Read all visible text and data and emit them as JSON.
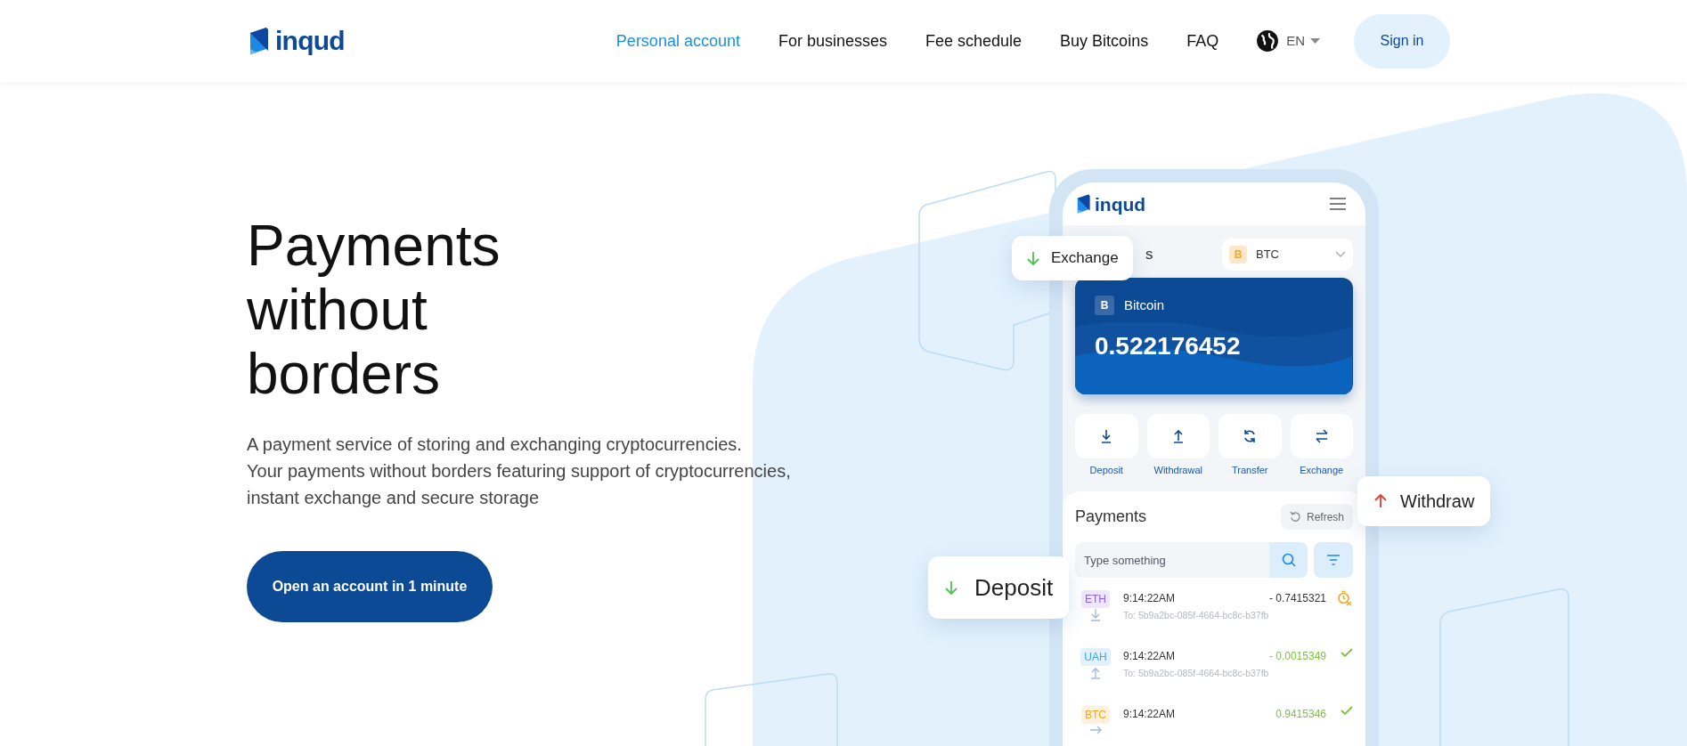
{
  "header": {
    "logo": "inqud",
    "nav": [
      {
        "label": "Personal account",
        "selected": true
      },
      {
        "label": "For businesses",
        "selected": false
      },
      {
        "label": "Fee schedule",
        "selected": false
      },
      {
        "label": "Buy Bitcoins",
        "selected": false
      },
      {
        "label": "FAQ",
        "selected": false
      }
    ],
    "language": "EN",
    "sign_in": "Sign in"
  },
  "hero": {
    "title_lines": [
      "Payments",
      "without",
      "borders"
    ],
    "description_lines": [
      "A payment service of storing and exchanging cryptocurrencies.",
      "Your payments without borders featuring support of cryptocurrencies,",
      "instant exchange and secure storage"
    ],
    "cta": "Open an account in 1 minute"
  },
  "phone": {
    "logo": "inqud",
    "section_title_visible": "s",
    "currency": {
      "symbol": "B",
      "code": "BTC"
    },
    "card": {
      "symbol": "B",
      "name": "Bitcoin",
      "balance": "0.522176452"
    },
    "actions": [
      {
        "kind": "deposit",
        "label": "Deposit"
      },
      {
        "kind": "withdrawal",
        "label": "Withdrawal"
      },
      {
        "kind": "transfer",
        "label": "Transfer"
      },
      {
        "kind": "exchange",
        "label": "Exchange"
      }
    ],
    "payments": {
      "title": "Payments",
      "refresh": "Refresh",
      "search_placeholder": "Type something",
      "rows": [
        {
          "coin": "ETH",
          "color": "#8b5cf6",
          "time": "9:14:22AM",
          "amount": "- 0.7415321",
          "to": "To: 5b9a2bc-085f-4664-bc8c-b37fb",
          "kind": "deposit",
          "pending": true
        },
        {
          "coin": "UAH",
          "color": "#38a6f0",
          "time": "9:14:22AM",
          "amount": "- 0.0015349",
          "to": "To: 5b9a2bc-085f-4664-bc8c-b37fb",
          "kind": "withdrawal",
          "pending": false
        },
        {
          "coin": "BTC",
          "color": "#f5a623",
          "time": "9:14:22AM",
          "amount": "0.9415346",
          "kind": "transfer",
          "pending": false
        }
      ]
    }
  },
  "popups": [
    {
      "kind": "in",
      "label": "Exchange"
    },
    {
      "kind": "out",
      "label": "Withdraw"
    },
    {
      "kind": "in",
      "label": "Deposit"
    }
  ]
}
